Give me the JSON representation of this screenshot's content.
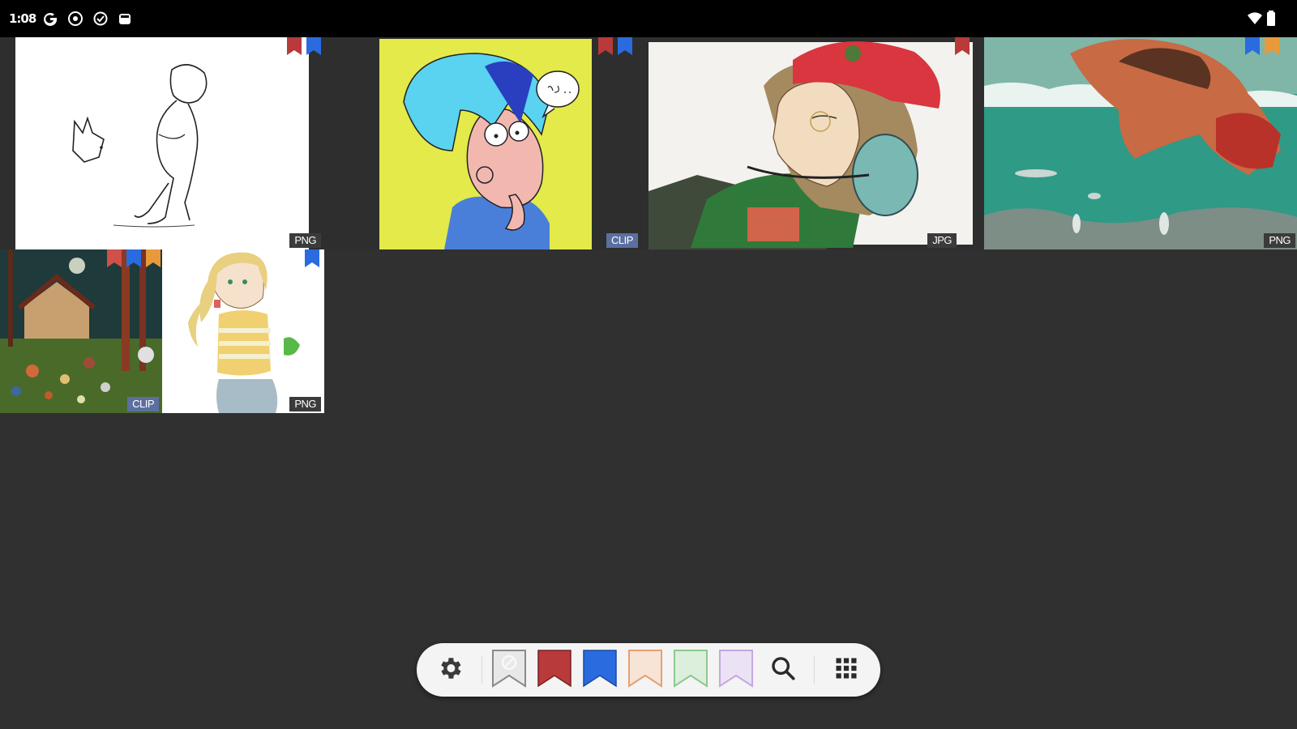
{
  "status_bar": {
    "time": "1:08",
    "icons": [
      "google-g-icon",
      "notification-icon",
      "shield-icon",
      "sdcard-icon",
      "wifi-icon",
      "battery-icon"
    ]
  },
  "gallery": {
    "items": [
      {
        "format": "PNG",
        "bookmarks": [
          "red",
          "blue"
        ]
      },
      {
        "format": "",
        "bookmarks": []
      },
      {
        "format": "CLIP",
        "bookmarks": [
          "red",
          "blue"
        ]
      },
      {
        "format": "JPG",
        "bookmarks": [
          "red"
        ]
      },
      {
        "format": "PNG",
        "bookmarks": [
          "blue",
          "orange"
        ]
      },
      {
        "format": "CLIP",
        "bookmarks": [
          "red",
          "blue",
          "orange"
        ]
      },
      {
        "format": "PNG",
        "bookmarks": [
          "blue"
        ]
      }
    ]
  },
  "toolbar": {
    "buttons": [
      "settings",
      "bookmark-none",
      "bookmark-red",
      "bookmark-blue",
      "bookmark-orange",
      "bookmark-green",
      "bookmark-purple",
      "search",
      "grid"
    ]
  },
  "colors": {
    "background": "#303030",
    "bookmark_red": "#b83a3a",
    "bookmark_blue": "#2a6be0",
    "bookmark_orange": "#e7b48a",
    "bookmark_green": "#a8d5a8",
    "bookmark_purple": "#cdb6e6",
    "clip_badge": "#5b6fa0"
  }
}
